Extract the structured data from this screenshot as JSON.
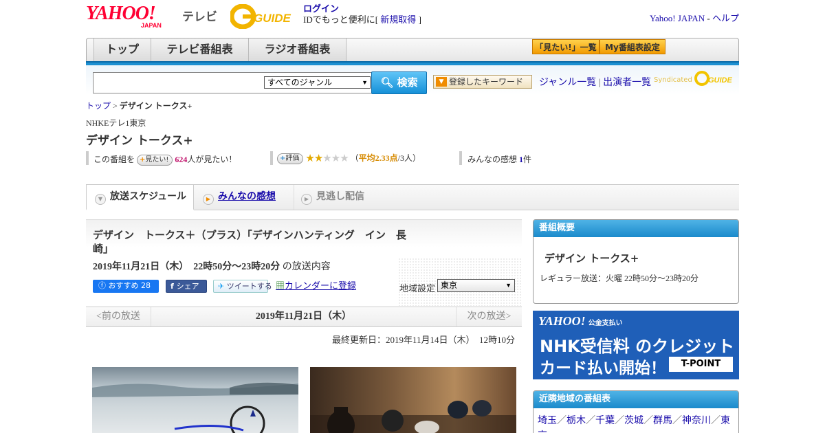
{
  "header": {
    "logo_yahoo": "YAHOO!",
    "logo_japan": "JAPAN",
    "logo_tv": "テレビ",
    "gguide": "GUIDE",
    "login": "ログイン",
    "login_sub_prefix": "IDでもっと便利に[ ",
    "register": "新規取得",
    "login_sub_suffix": " ]",
    "yahoo_japan": "Yahoo! JAPAN",
    "dash": " - ",
    "help": "ヘルプ"
  },
  "nav": {
    "tabs": [
      {
        "label": "トップ"
      },
      {
        "label": "テレビ番組表"
      },
      {
        "label": "ラジオ番組表"
      }
    ],
    "mitai_list": "「見たい!」一覧",
    "my_bangumi": "My番組表設定"
  },
  "search": {
    "genre_selected": "すべてのジャンル",
    "button": "検索",
    "keyword_button": "登録したキーワード",
    "genre_list": "ジャンル一覧",
    "separator": " | ",
    "performer_list": "出演者一覧",
    "syndicated": "Syndicated"
  },
  "breadcrumb": {
    "top": "トップ",
    "sep": " > ",
    "current": "デザイン トークス+"
  },
  "program": {
    "channel": "NHKEテレ1東京",
    "title": "デザイン トークス+",
    "stats": {
      "prefix": "この番組を",
      "mitai_btn": "見たい!",
      "mitai_count": "624",
      "mitai_suffix": "人が見たい！",
      "rating_btn": "評価",
      "rating_stars": 2.33,
      "rating_open": "（",
      "rating_avg": "平均2.33点",
      "rating_people": "/3人）",
      "kanso_label": "みんなの感想",
      "kanso_count": "1",
      "kanso_unit": "件"
    }
  },
  "subtabs": {
    "schedule": "放送スケジュール",
    "kanso": "みんなの感想",
    "minogashi": "見逃し配信"
  },
  "broadcast": {
    "title": "デザイン　トークス＋（プラス）「デザインハンティング　イン　長崎」",
    "date": "2019年11月21日（木）　22時50分～23時20分",
    "date_suffix": "の放送内容",
    "fb_like": "おすすめ 28",
    "fb_share": "シェア",
    "tweet": "ツイートする",
    "calendar": "カレンダーに登録",
    "region_label": "地域設定",
    "region_value": "東京"
  },
  "pager": {
    "prev": "<前の放送",
    "current": "2019年11月21日（木）",
    "next": "次の放送>"
  },
  "updated": "最終更新日：2019年11月14日（木）　12時10分",
  "overview": {
    "heading": "番組概要",
    "title": "デザイン トークス+",
    "regular": "レギュラー放送：火曜 22時50分～23時20分"
  },
  "ad": {
    "logo": "YAHOO!",
    "logo_sub": "公金支払い",
    "line1": "NHK受信料 のクレジット",
    "line2": "カード払い開始！",
    "tpoint": "T-POINT"
  },
  "nearby": {
    "heading": "近隣地域の番組表",
    "regions": [
      "埼玉",
      "栃木",
      "千葉",
      "茨城",
      "群馬",
      "神奈川",
      "東京"
    ]
  },
  "colors": {
    "accent_blue": "#1c8fd1",
    "brand_red": "#ff0033",
    "star": "#e3a900",
    "mitai_count": "#c0106a"
  }
}
